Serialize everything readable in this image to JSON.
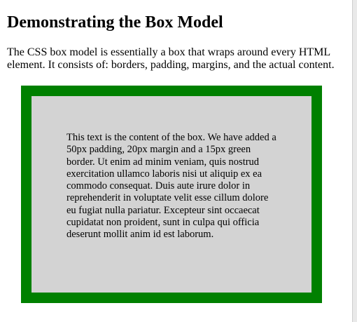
{
  "heading": "Demonstrating the Box Model",
  "intro": "The CSS box model is essentially a box that wraps around every HTML element. It consists of: borders, padding, margins, and the actual content.",
  "box": {
    "content": "This text is the content of the box. We have added a 50px padding, 20px margin and a 15px green border. Ut enim ad minim veniam, quis nostrud exercitation ullamco laboris nisi ut aliquip ex ea commodo consequat. Duis aute irure dolor in reprehenderit in voluptate velit esse cillum dolore eu fugiat nulla pariatur. Excepteur sint occaecat cupidatat non proident, sunt in culpa qui officia deserunt mollit anim id est laborum.",
    "border_color": "#008000",
    "background_color": "#d3d3d3"
  }
}
